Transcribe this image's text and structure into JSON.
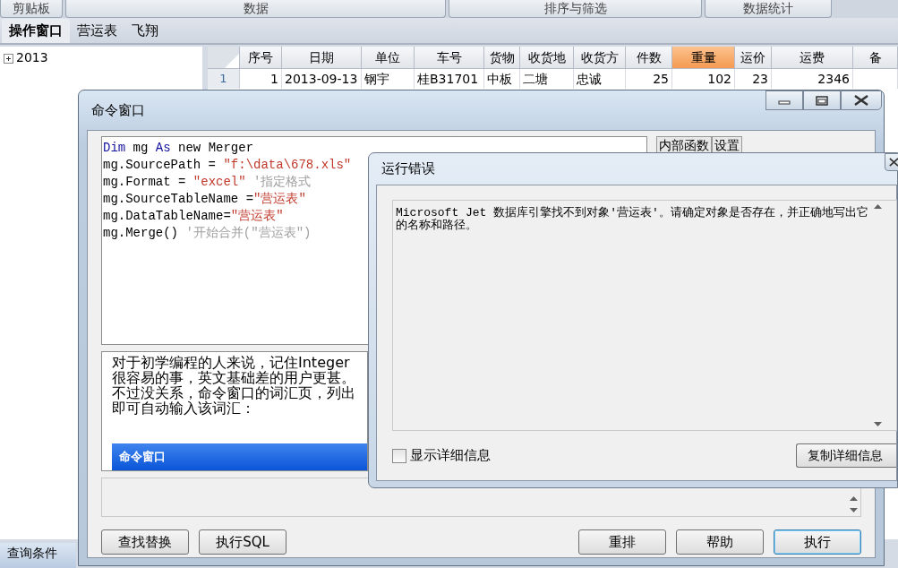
{
  "ribbon_groups": [
    "剪贴板",
    "数据",
    "排序与筛选",
    "数据统计"
  ],
  "tabs": [
    {
      "label": "操作窗口",
      "selected": true
    },
    {
      "label": "营运表",
      "selected": false
    },
    {
      "label": "飞翔",
      "selected": false
    }
  ],
  "tree": [
    {
      "label": "2013",
      "expanded": false
    }
  ],
  "table": {
    "columns": [
      {
        "label": "序号",
        "selected": false
      },
      {
        "label": "日期",
        "selected": false
      },
      {
        "label": "单位",
        "selected": false
      },
      {
        "label": "车号",
        "selected": false
      },
      {
        "label": "货物",
        "selected": false
      },
      {
        "label": "收货地",
        "selected": false
      },
      {
        "label": "收货方",
        "selected": false
      },
      {
        "label": "件数",
        "selected": false
      },
      {
        "label": "重量",
        "selected": true
      },
      {
        "label": "运价",
        "selected": false
      },
      {
        "label": "运费",
        "selected": false
      },
      {
        "label": "备",
        "selected": false
      }
    ],
    "rows": [
      {
        "number": "1",
        "cells": [
          "1",
          "2013-09-13",
          "钢宇",
          "桂B31701",
          "中板",
          "二塘",
          "忠诚",
          "25",
          "102",
          "23",
          "2346",
          ""
        ]
      }
    ]
  },
  "query_panel": {
    "label": "查询条件"
  },
  "command_window": {
    "title": "命令窗口",
    "code_lines": [
      [
        {
          "kind": "keyword",
          "text": "Dim"
        },
        {
          "kind": "plain",
          "text": " mg "
        },
        {
          "kind": "keyword",
          "text": "As"
        },
        {
          "kind": "plain",
          "text": " new Merger"
        }
      ],
      [
        {
          "kind": "plain",
          "text": "mg.SourcePath = "
        },
        {
          "kind": "string",
          "text": "\"f:\\data\\678.xls\""
        }
      ],
      [
        {
          "kind": "plain",
          "text": "mg.Format = "
        },
        {
          "kind": "string",
          "text": "\"excel\""
        },
        {
          "kind": "comment",
          "text": " '指定格式"
        }
      ],
      [
        {
          "kind": "plain",
          "text": "mg.SourceTableName ="
        },
        {
          "kind": "string",
          "text": "\"营运表\""
        }
      ],
      [
        {
          "kind": "plain",
          "text": "mg.DataTableName="
        },
        {
          "kind": "string",
          "text": "\"营运表\""
        }
      ],
      [
        {
          "kind": "plain",
          "text": "mg.Merge() "
        },
        {
          "kind": "comment",
          "text": "'开始合并(\"营运表\")"
        }
      ]
    ],
    "side_tabs": [
      "内部函数",
      "设置"
    ],
    "help_lines": [
      "对于初学编程的人来说，记住Integer",
      "很容易的事，英文基础差的用户更甚。",
      "不过没关系，命令窗口的词汇页，列出",
      "即可自动输入该词汇："
    ],
    "highlight_row": "命令窗口",
    "left_buttons": [
      {
        "label": "查找替换",
        "default": false
      },
      {
        "label": "执行SQL",
        "default": false
      }
    ],
    "right_buttons": [
      {
        "label": "重排",
        "default": false
      },
      {
        "label": "帮助",
        "default": false
      },
      {
        "label": "执行",
        "default": true
      }
    ]
  },
  "error_dialog": {
    "title": "运行错误",
    "message": "Microsoft Jet 数据库引擎找不到对象'营运表'。请确定对象是否存在，并正确地写出它的名称和路径。",
    "show_details": {
      "label": "显示详细信息",
      "checked": false
    },
    "copy_button": "复制详细信息"
  }
}
